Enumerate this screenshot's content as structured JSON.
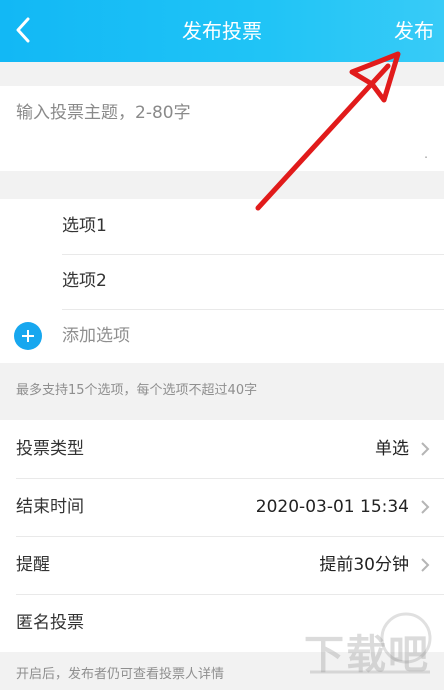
{
  "header": {
    "title": "发布投票",
    "publish_label": "发布",
    "back_icon": "chevron-left-icon",
    "colors": {
      "start": "#12b8f5",
      "end": "#38cbf7"
    }
  },
  "topic": {
    "placeholder": "输入投票主题，2-80字",
    "dot": "."
  },
  "options": {
    "items": [
      {
        "label": "选项1"
      },
      {
        "label": "选项2"
      }
    ],
    "add_label": "添加选项",
    "add_icon": "plus-circle-icon",
    "accent": "#17a7ef"
  },
  "tip": "最多支持15个选项，每个选项不超过40字",
  "settings": {
    "type": {
      "label": "投票类型",
      "value": "单选"
    },
    "end_time": {
      "label": "结束时间",
      "value": "2020-03-01 15:34"
    },
    "reminder": {
      "label": "提醒",
      "value": "提前30分钟"
    },
    "anonymous": {
      "label": "匿名投票"
    }
  },
  "footer_tip": "开启后，发布者仍可查看投票人详情",
  "watermark": {
    "text": "下载吧"
  }
}
